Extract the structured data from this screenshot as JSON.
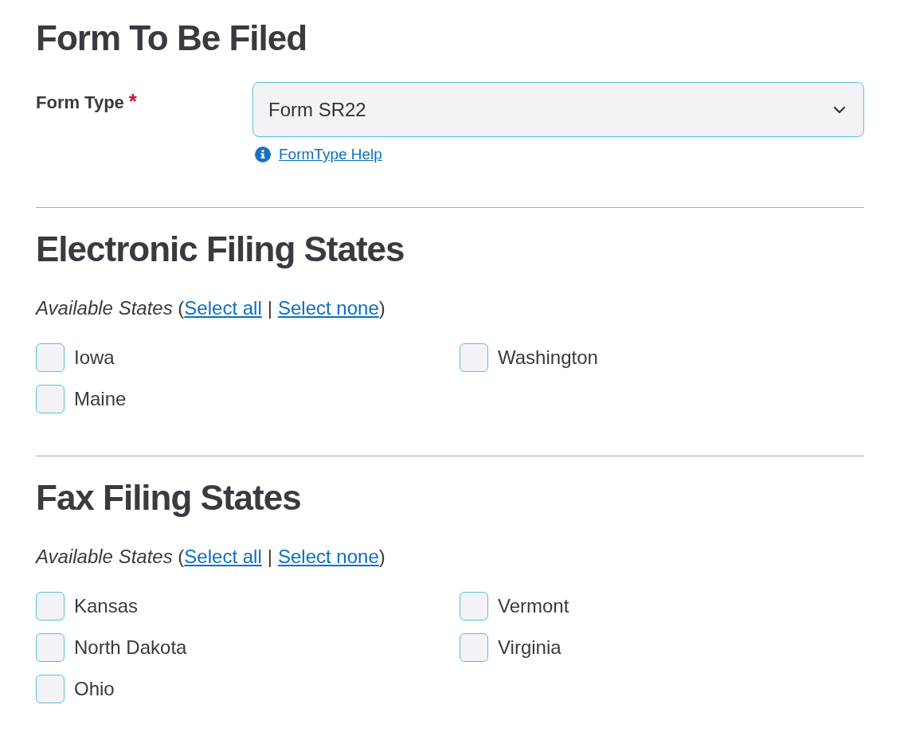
{
  "sections": [
    {
      "kind": "form_type",
      "title": "Form To Be Filed",
      "label": "Form Type",
      "required_mark": "*",
      "value": "Form SR22",
      "help_link": "FormType Help"
    },
    {
      "kind": "states",
      "title": "Electronic Filing States",
      "intro": "*Available States* (",
      "select_all": "Select all",
      "separator": "|",
      "select_none": "Select none",
      "intro_end": ")",
      "states": [
        {
          "label": "Iowa",
          "checked": false
        },
        {
          "label": "Maine",
          "checked": false
        },
        {
          "label": "Washington",
          "checked": false
        }
      ]
    },
    {
      "kind": "states",
      "title": "Fax Filing States",
      "intro": "*Available States* (",
      "select_all": "Select all",
      "separator": "|",
      "select_none": "Select none",
      "intro_end": ")",
      "states": [
        {
          "label": "Kansas",
          "checked": false
        },
        {
          "label": "North Dakota",
          "checked": false
        },
        {
          "label": "Ohio",
          "checked": false
        },
        {
          "label": "Vermont",
          "checked": false
        },
        {
          "label": "Virginia",
          "checked": false
        }
      ]
    }
  ]
}
